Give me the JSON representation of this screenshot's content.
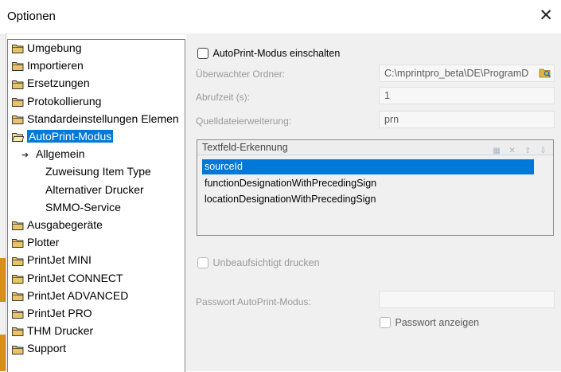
{
  "window": {
    "title": "Optionen",
    "close_glyph": "✕"
  },
  "colors": {
    "accent": "#0078d7",
    "folder": "#e8c466",
    "panel_bg": "#f0f0f0"
  },
  "tree": {
    "items": [
      {
        "label": "Umgebung",
        "icon": "folder-icon"
      },
      {
        "label": "Importieren",
        "icon": "folder-icon"
      },
      {
        "label": "Ersetzungen",
        "icon": "folder-icon"
      },
      {
        "label": "Protokollierung",
        "icon": "folder-icon"
      },
      {
        "label": "Standardeinstellungen Elemen",
        "icon": "folder-icon"
      },
      {
        "label": "AutoPrint-Modus",
        "icon": "folder-open-icon",
        "selected": true
      },
      {
        "label": "Allgemein",
        "icon": "arrow-icon"
      },
      {
        "label": "Zuweisung Item Type",
        "icon": "none"
      },
      {
        "label": "Alternativer Drucker",
        "icon": "none"
      },
      {
        "label": "SMMO-Service",
        "icon": "none"
      },
      {
        "label": "Ausgabegeräte",
        "icon": "folder-icon"
      },
      {
        "label": "Plotter",
        "icon": "folder-icon"
      },
      {
        "label": "PrintJet MINI",
        "icon": "folder-icon"
      },
      {
        "label": "PrintJet CONNECT",
        "icon": "folder-icon"
      },
      {
        "label": "PrintJet ADVANCED",
        "icon": "folder-icon"
      },
      {
        "label": "PrintJet PRO",
        "icon": "folder-icon"
      },
      {
        "label": "THM Drucker",
        "icon": "folder-icon"
      },
      {
        "label": "Support",
        "icon": "folder-icon"
      }
    ]
  },
  "panel": {
    "enable_label": "AutoPrint-Modus einschalten",
    "watched_folder_label": "Überwachter Ordner:",
    "watched_folder_value": "C:\\mprintpro_beta\\DE\\ProgramD",
    "poll_label": "Abrufzeit (s):",
    "poll_value": "1",
    "ext_label": "Quelldateierweiterung:",
    "ext_value": "prn",
    "textfield_header": "Textfeld-Erkennung",
    "textfield_items": [
      "sourceId",
      "functionDesignationWithPrecedingSign",
      "locationDesignationWithPrecedingSign"
    ],
    "unattended_label": "Unbeaufsichtigt drucken",
    "password_label": "Passwort AutoPrint-Modus:",
    "password_value": "",
    "show_password_label": "Passwort anzeigen"
  }
}
